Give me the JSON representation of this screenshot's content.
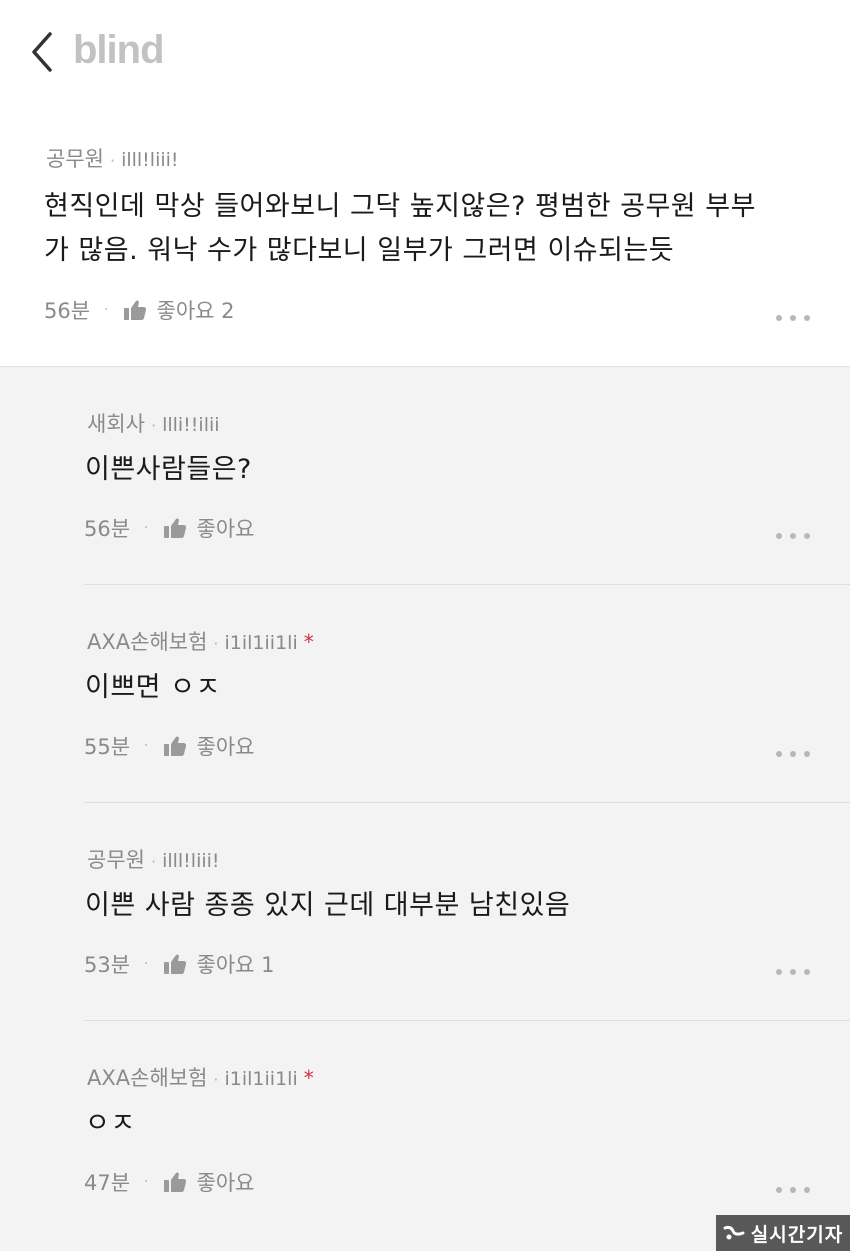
{
  "header": {
    "logo": "blind"
  },
  "main_comment": {
    "company": "공무원",
    "nickname": "illl!liii!",
    "text_line1": "현직인데 막상 들어와보니 그닥 높지않은? 평범한 공무원 부부",
    "text_line2": "가 많음. 워낙 수가 많다보니 일부가 그러면 이슈되는듯",
    "time": "56분",
    "like_label": "좋아요 2"
  },
  "replies": [
    {
      "company": "새회사",
      "nickname": "llli!!ilii",
      "verified": false,
      "text": "이쁜사람들은?",
      "time": "56분",
      "like_label": "좋아요"
    },
    {
      "company": "AXA손해보험",
      "nickname": "i1il1ii1li",
      "verified": true,
      "star": "*",
      "text": "이쁘면 ㅇㅈ",
      "time": "55분",
      "like_label": "좋아요"
    },
    {
      "company": "공무원",
      "nickname": "illl!liii!",
      "verified": false,
      "text": "이쁜 사람 종종 있지 근데 대부분 남친있음",
      "time": "53분",
      "like_label": "좋아요 1"
    },
    {
      "company": "AXA손해보험",
      "nickname": "i1il1ii1li",
      "verified": true,
      "star": "*",
      "text": "ㅇㅈ",
      "time": "47분",
      "like_label": "좋아요"
    }
  ],
  "separator_dot": "·",
  "watermark": {
    "text": "실시간기자",
    "logo_icon": "news-logo-icon"
  },
  "icons": {
    "back": "chevron-left-icon",
    "like": "thumbs-up-icon",
    "more": "more-horizontal-icon"
  },
  "colors": {
    "logo": "#c2c2c2",
    "meta_text": "#8a8a8a",
    "body_text": "#1a1a1a",
    "reply_bg": "#f3f3f3",
    "star": "#d0313f"
  }
}
